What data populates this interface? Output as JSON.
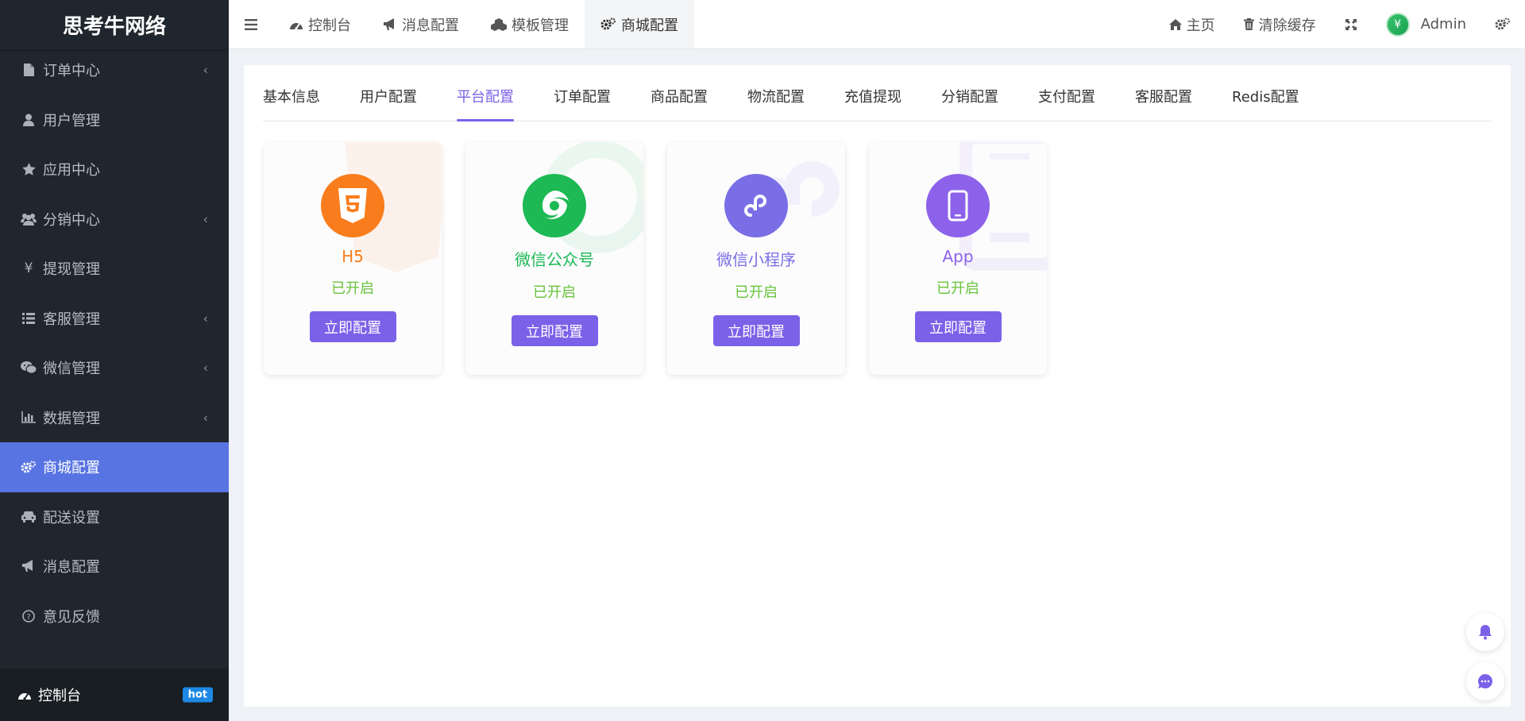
{
  "brand": {
    "name": "思考牛网络"
  },
  "sidebar": {
    "items": [
      {
        "label": "订单中心",
        "icon": "file-icon",
        "has_children": true
      },
      {
        "label": "用户管理",
        "icon": "user-icon",
        "has_children": false
      },
      {
        "label": "应用中心",
        "icon": "star-icon",
        "has_children": false
      },
      {
        "label": "分销中心",
        "icon": "users-icon",
        "has_children": true
      },
      {
        "label": "提现管理",
        "icon": "yen-icon",
        "has_children": false
      },
      {
        "label": "客服管理",
        "icon": "list-icon",
        "has_children": true
      },
      {
        "label": "微信管理",
        "icon": "wechat-icon",
        "has_children": true
      },
      {
        "label": "数据管理",
        "icon": "bar-chart-icon",
        "has_children": true
      },
      {
        "label": "商城配置",
        "icon": "cogs-icon",
        "has_children": false,
        "active": true
      },
      {
        "label": "配送设置",
        "icon": "car-icon",
        "has_children": false
      },
      {
        "label": "消息配置",
        "icon": "bullhorn-icon",
        "has_children": false
      },
      {
        "label": "意见反馈",
        "icon": "question-icon",
        "has_children": false
      }
    ],
    "chevron": "‹",
    "footer": {
      "label": "控制台",
      "badge": "hot"
    }
  },
  "topbar": {
    "tabs": [
      {
        "label": "控制台",
        "icon": "dashboard-icon"
      },
      {
        "label": "消息配置",
        "icon": "bullhorn-icon"
      },
      {
        "label": "模板管理",
        "icon": "cubes-icon"
      },
      {
        "label": "商城配置",
        "icon": "cogs-icon",
        "active": true
      }
    ],
    "home_label": "主页",
    "clear_cache_label": "清除缓存",
    "user_name": "Admin",
    "avatar_glyph": "¥"
  },
  "subtabs": [
    "基本信息",
    "用户配置",
    "平台配置",
    "订单配置",
    "商品配置",
    "物流配置",
    "充值提现",
    "分销配置",
    "支付配置",
    "客服配置",
    "Redis配置"
  ],
  "subtab_active_index": 2,
  "cards": [
    {
      "name": "H5",
      "status": "已开启",
      "button": "立即配置",
      "color": "#f97d1c",
      "icon": "html5-icon"
    },
    {
      "name": "微信公众号",
      "status": "已开启",
      "button": "立即配置",
      "color": "#1db954",
      "icon": "wechat-official-icon"
    },
    {
      "name": "微信小程序",
      "status": "已开启",
      "button": "立即配置",
      "color": "#7a6ee6",
      "icon": "miniprogram-icon"
    },
    {
      "name": "App",
      "status": "已开启",
      "button": "立即配置",
      "color": "#8c62ea",
      "icon": "mobile-icon"
    }
  ],
  "colors": {
    "accent": "#7b61e8",
    "sidebar_active": "#5874e2",
    "status_green": "#67c23a"
  }
}
